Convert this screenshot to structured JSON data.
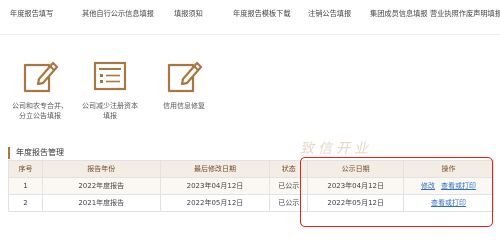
{
  "nav": {
    "items": [
      "年度报告填写",
      "其他自行公示信息填报",
      "填报须知",
      "年度报告模板下载",
      "注销公告填报",
      "集团成员信息填报",
      "营业执照作废声明填报"
    ]
  },
  "cards": [
    {
      "icon": "edit-icon",
      "label": "公司和农专合并、分立公告填报"
    },
    {
      "icon": "list-document-icon",
      "label": "公司减少注册资本填报"
    },
    {
      "icon": "edit-icon",
      "label": "信用信息修复"
    }
  ],
  "section": {
    "title": "年度报告管理"
  },
  "watermark": "致信开业",
  "table": {
    "headers": [
      "序号",
      "报告年份",
      "最后修改日期",
      "状态",
      "公示日期",
      "操作"
    ],
    "rows": [
      {
        "index": "1",
        "year": "2022年度报告",
        "modified": "2023年04月12日",
        "status": "已公示",
        "publish_date": "2023年04月12日",
        "actions": [
          "修改",
          "查看或打印"
        ]
      },
      {
        "index": "2",
        "year": "2021年度报告",
        "modified": "2022年05月12日",
        "status": "已公示",
        "publish_date": "2022年05月12日",
        "actions": [
          "查看或打印"
        ]
      }
    ]
  },
  "colors": {
    "icon_accent": "#a87842",
    "highlight": "#e8231d",
    "header_bg": "#f3ede6",
    "link": "#2f6fc4"
  }
}
